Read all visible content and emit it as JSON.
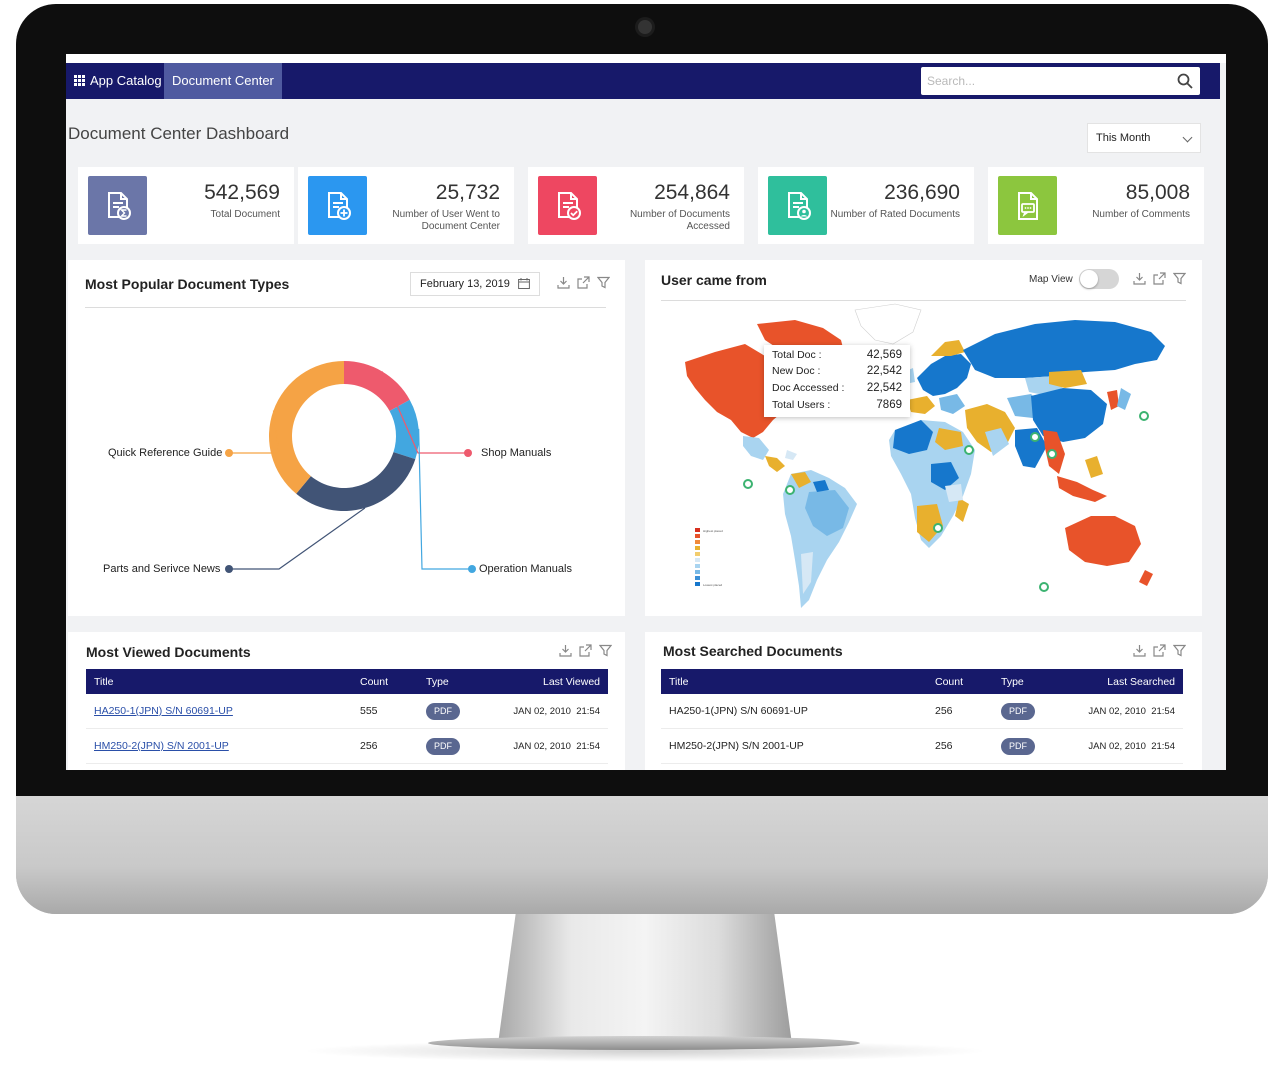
{
  "nav": {
    "app_catalog": "App Catalog",
    "document_center": "Document Center"
  },
  "search": {
    "placeholder": "Search..."
  },
  "page": {
    "title": "Document Center Dashboard",
    "period": "This Month"
  },
  "kpis": [
    {
      "value": "542,569",
      "label": "Total Document",
      "color": "#6b76a8",
      "icon": "document-sum-icon"
    },
    {
      "value": "25,732",
      "label": "Number of User Went to Document Center",
      "color": "#2b97f0",
      "icon": "document-add-icon"
    },
    {
      "value": "254,864",
      "label": "Number of Documents Accessed",
      "color": "#ee4761",
      "icon": "document-check-icon"
    },
    {
      "value": "236,690",
      "label": "Number of Rated Documents",
      "color": "#2fbf9c",
      "icon": "document-user-icon"
    },
    {
      "value": "85,008",
      "label": "Number of Comments",
      "color": "#8cc63e",
      "icon": "document-comment-icon"
    }
  ],
  "popular": {
    "title": "Most Popular Document Types",
    "date": "February 13, 2019",
    "chart_data": {
      "type": "pie",
      "title": "",
      "categories": [
        "Shop Manuals",
        "Operation Manuals",
        "Parts and Serivce News",
        "Quick Reference Guide"
      ],
      "values": [
        17,
        13,
        31,
        39
      ],
      "colors": [
        "#ee5a6d",
        "#42a7e0",
        "#415476",
        "#f5a345"
      ]
    }
  },
  "map": {
    "title": "User came from",
    "toggle_label": "Map View",
    "legend_top": "Highest placed",
    "legend_bottom": "Lowest placed",
    "tooltip": {
      "rows": [
        {
          "key": "Total Doc :",
          "value": "42,569"
        },
        {
          "key": "New Doc :",
          "value": "22,542"
        },
        {
          "key": "Doc Accessed :",
          "value": "22,542"
        },
        {
          "key": "Total Users :",
          "value": "7869"
        }
      ]
    }
  },
  "most_viewed": {
    "title": "Most Viewed Documents",
    "headers": {
      "title": "Title",
      "count": "Count",
      "type": "Type",
      "last": "Last Viewed"
    },
    "rows": [
      {
        "title": "HA250-1(JPN) S/N 60691-UP",
        "count": "555",
        "type": "PDF",
        "date": "JAN 02, 2010",
        "time": "21:54"
      },
      {
        "title": "HM250-2(JPN) S/N 2001-UP",
        "count": "256",
        "type": "PDF",
        "date": "JAN 02, 2010",
        "time": "21:54"
      }
    ]
  },
  "most_searched": {
    "title": "Most Searched Documents",
    "headers": {
      "title": "Title",
      "count": "Count",
      "type": "Type",
      "last": "Last Searched"
    },
    "rows": [
      {
        "title": "HA250-1(JPN) S/N 60691-UP",
        "count": "256",
        "type": "PDF",
        "date": "JAN 02, 2010",
        "time": "21:54"
      },
      {
        "title": "HM250-2(JPN) S/N 2001-UP",
        "count": "256",
        "type": "PDF",
        "date": "JAN 02, 2010",
        "time": "21:54"
      }
    ]
  }
}
